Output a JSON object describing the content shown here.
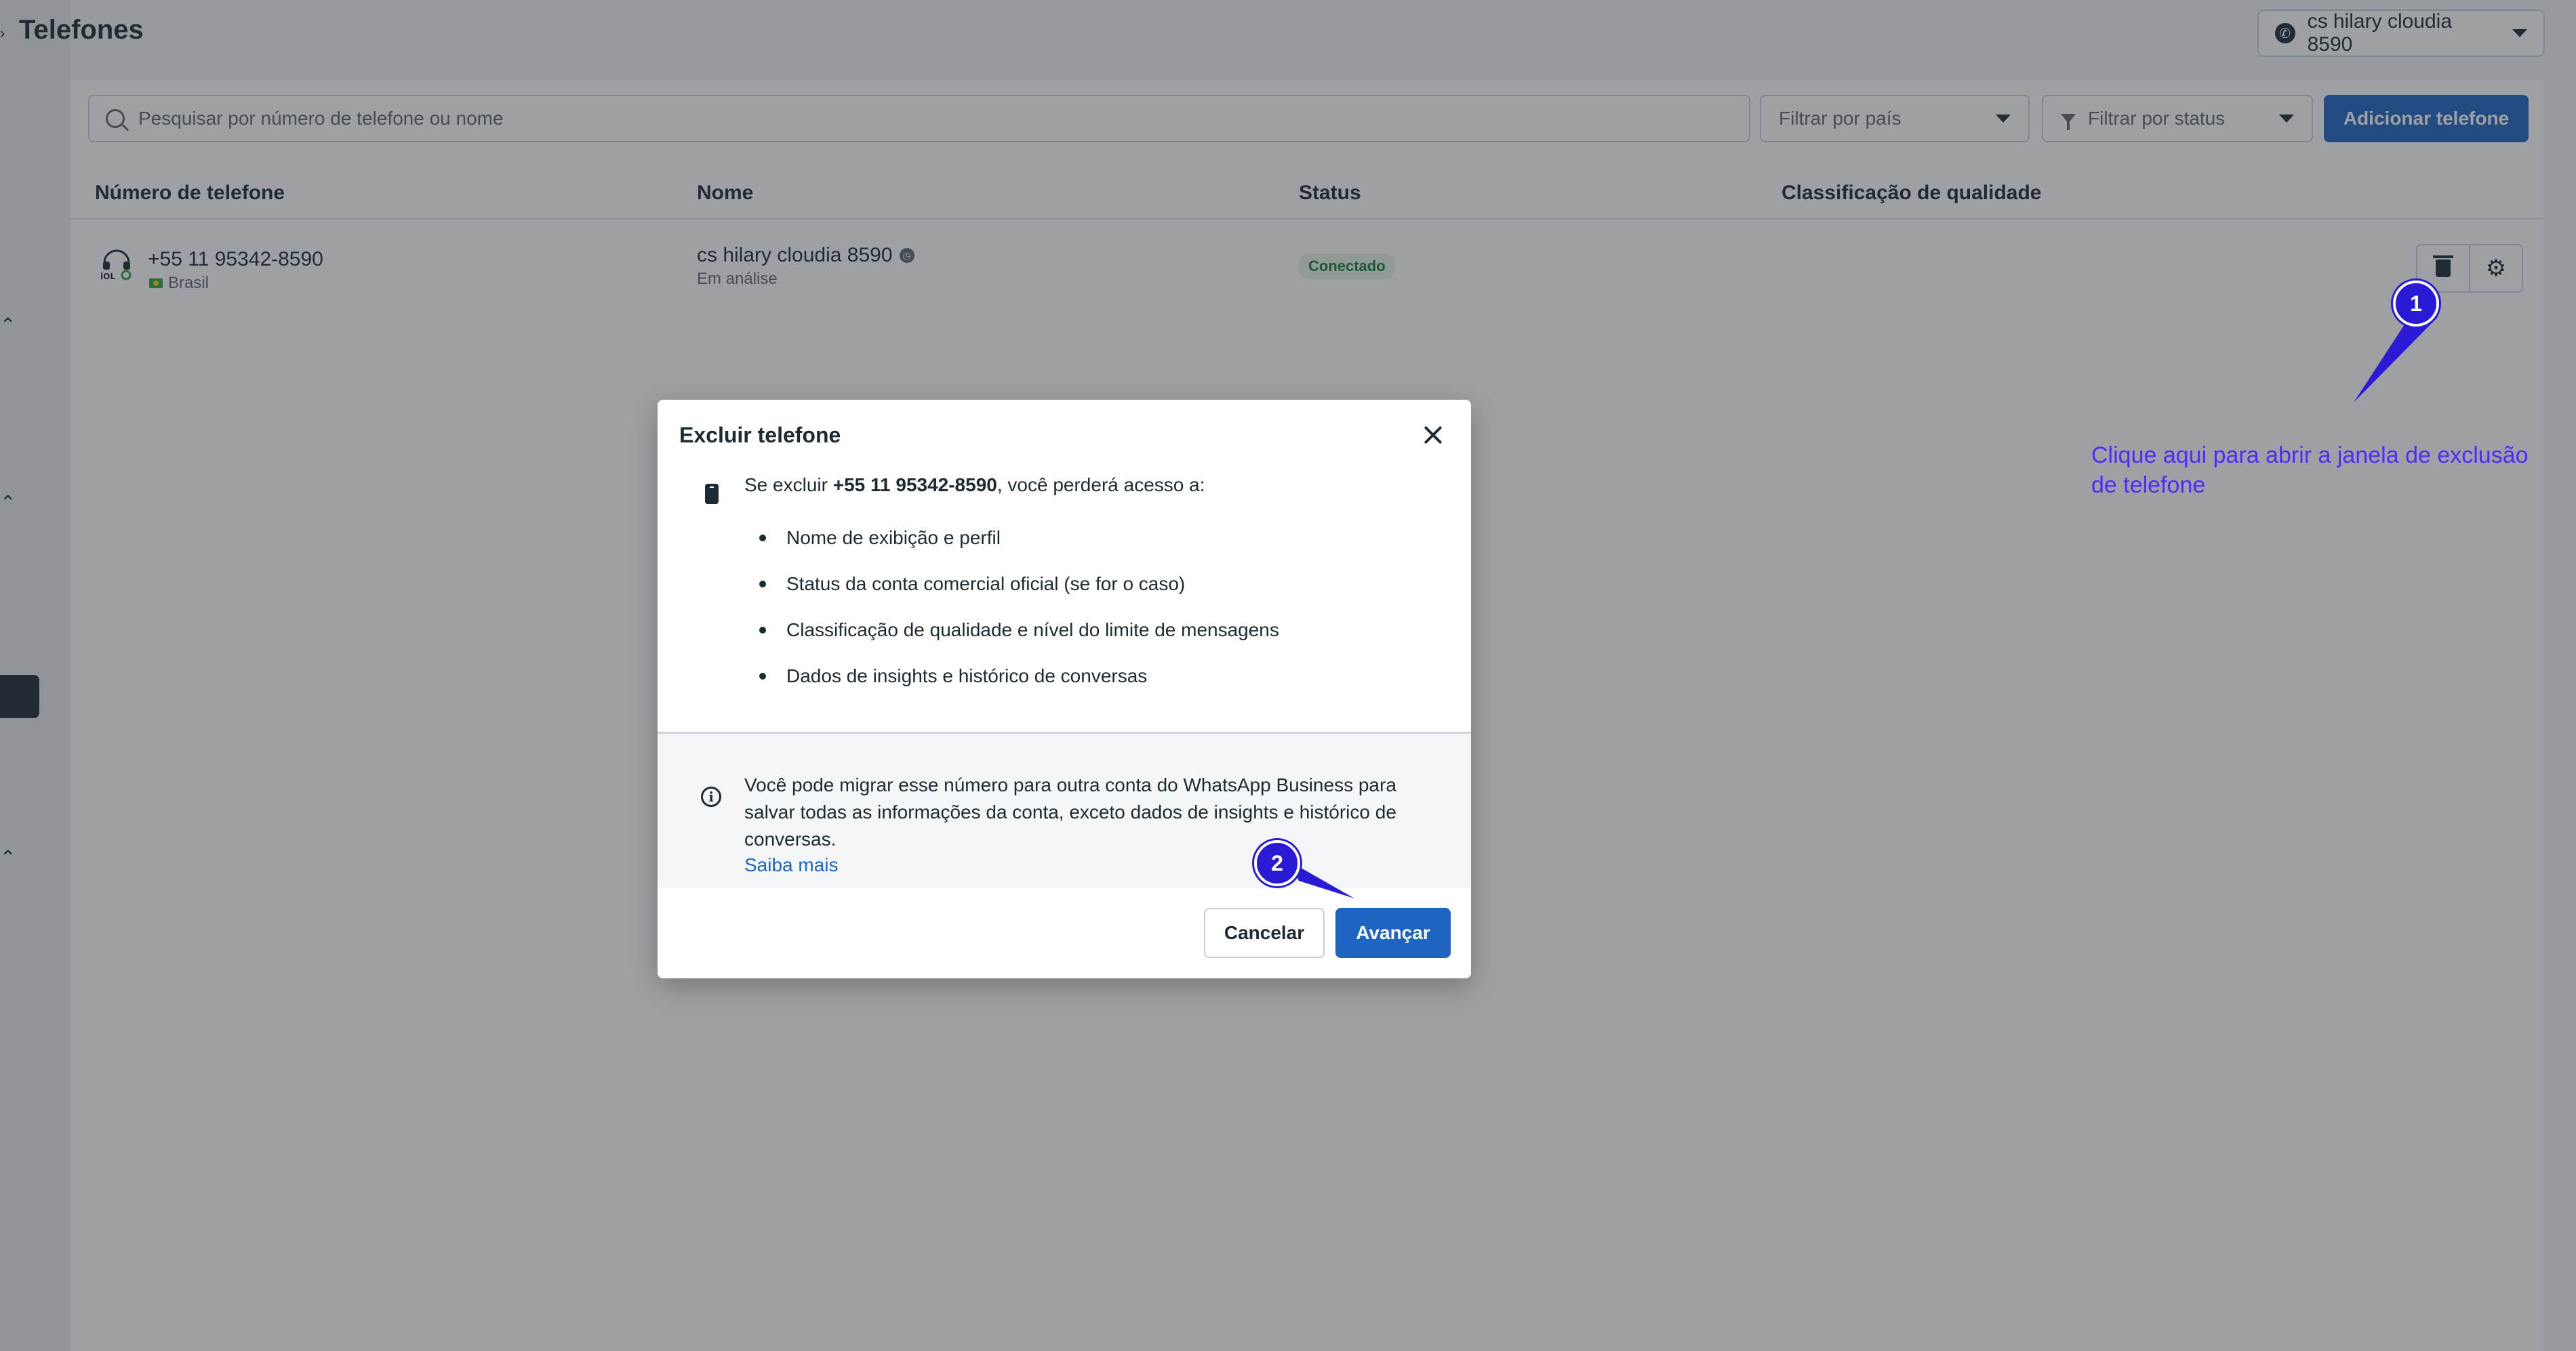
{
  "page": {
    "title": "Telefones",
    "account_name": "cs hilary cloudia 8590"
  },
  "toolbar": {
    "search_placeholder": "Pesquisar por número de telefone ou nome",
    "filter_country": "Filtrar por país",
    "filter_status": "Filtrar por status",
    "add_phone": "Adicionar telefone"
  },
  "table": {
    "columns": [
      "Número de telefone",
      "Nome",
      "Status",
      "Classificação de qualidade"
    ],
    "rows": [
      {
        "phone": "+55 11 95342-8590",
        "country": "Brasil",
        "name": "cs hilary cloudia 8590",
        "name_sub": "Em análise",
        "status": "Conectado"
      }
    ]
  },
  "modal": {
    "title": "Excluir telefone",
    "intro_prefix": "Se excluir ",
    "intro_phone": "+55 11 95342-8590",
    "intro_suffix": ", você perderá acesso a:",
    "items": [
      "Nome de exibição e perfil",
      "Status da conta comercial oficial (se for o caso)",
      "Classificação de qualidade e nível do limite de mensagens",
      "Dados de insights e histórico de conversas"
    ],
    "info": "Você pode migrar esse número para outra conta do WhatsApp Business para salvar todas as informações da conta, exceto dados de insights e histórico de conversas.",
    "learn_more": "Saiba mais",
    "cancel": "Cancelar",
    "next": "Avançar"
  },
  "annotations": {
    "step1": "1",
    "step2": "2",
    "note": "Clique aqui para abrir a janela de exclusão de telefone",
    "color": "#4b2bff"
  }
}
